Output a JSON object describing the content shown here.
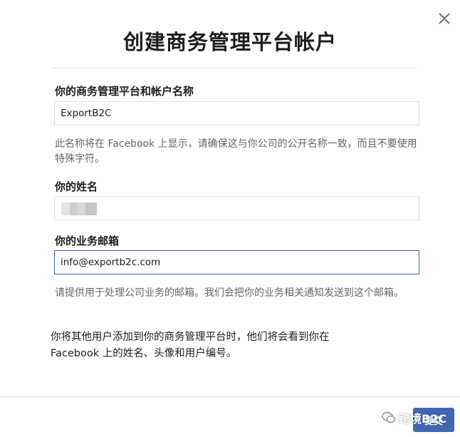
{
  "dialog": {
    "title": "创建商务管理平台帐户",
    "close_icon": "close-icon"
  },
  "business_name": {
    "label": "你的商务管理平台和帐户名称",
    "value": "ExportB2C",
    "help": "此名称将在 Facebook 上显示，请确保这与你公司的公开名称一致，而且不要使用特殊字符。"
  },
  "your_name": {
    "label": "你的姓名",
    "value": ""
  },
  "business_email": {
    "label": "你的业务邮箱",
    "value": "info@exportb2c.com",
    "help": "请提供用于处理公司业务的邮箱。我们会把你的业务相关通知发送到这个邮箱。"
  },
  "notice": "你将其他用户添加到你的商务管理平台时，他们将会看到你在 Facebook 上的姓名、头像和用户编号。",
  "footer": {
    "submit_label": "提交"
  },
  "watermark": {
    "text": "跨境B2C",
    "icon": "wechat-icon"
  },
  "colors": {
    "accent": "#4267b2",
    "border": "#dddfe2",
    "help_text": "#606770"
  }
}
